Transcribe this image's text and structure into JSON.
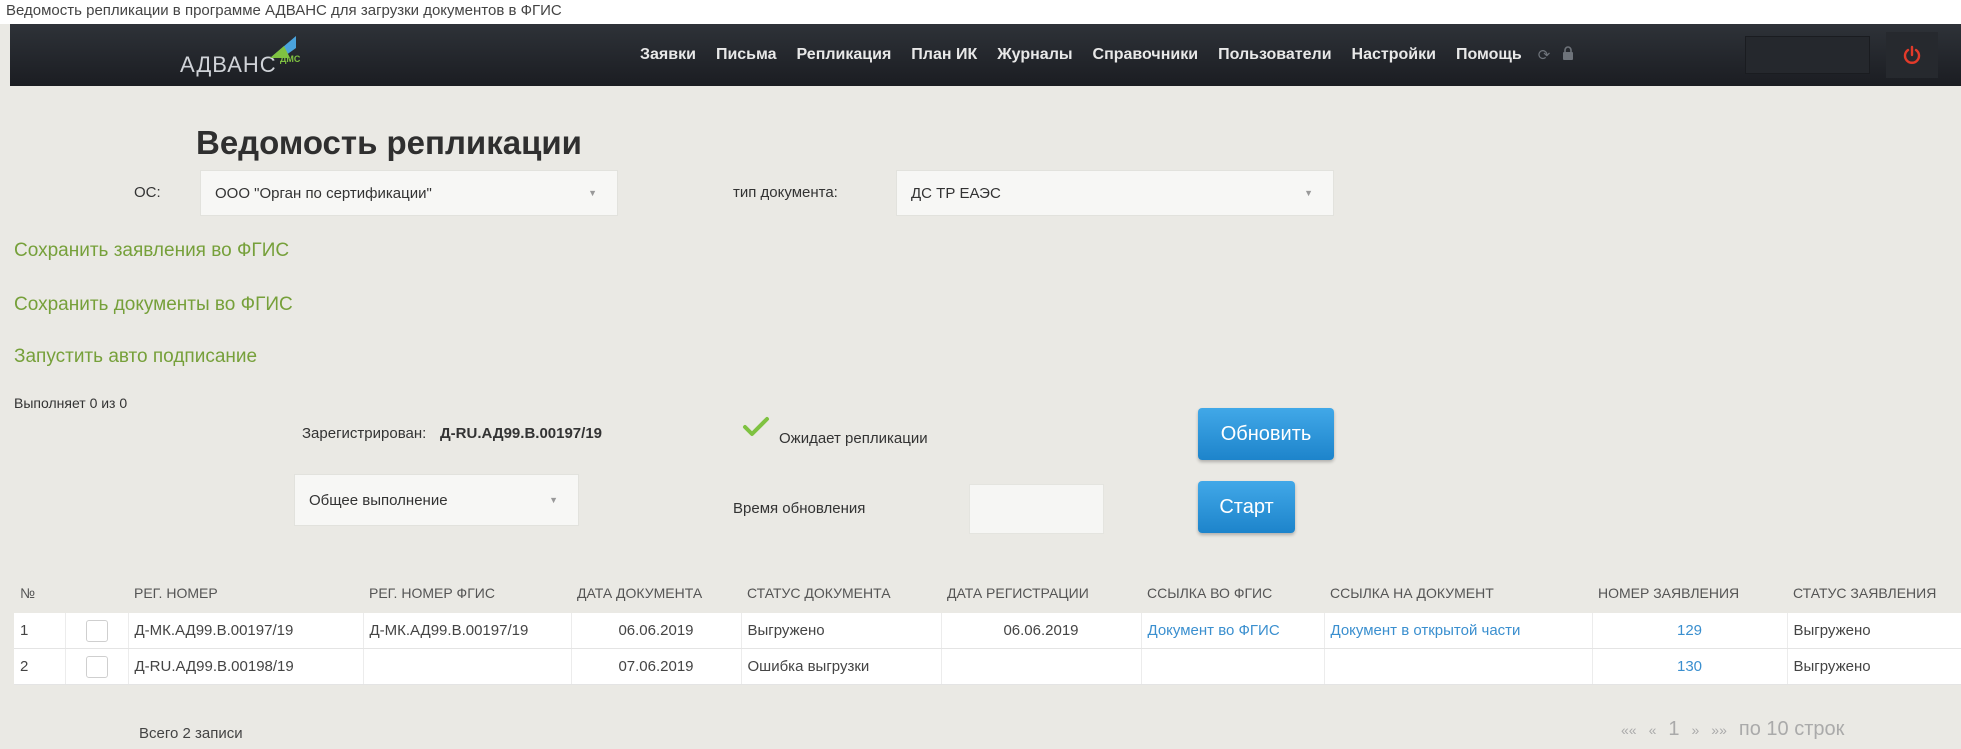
{
  "caption": "Ведомость репликации в программе АДВАНС для загрузки документов в ФГИС",
  "app": {
    "logo_text": "АДВАНС",
    "logo_sub": "ДМС",
    "accent": "#7fc241"
  },
  "nav": {
    "items": [
      "Заявки",
      "Письма",
      "Репликация",
      "План ИК",
      "Журналы",
      "Справочники",
      "Пользователи",
      "Настройки",
      "Помощь"
    ],
    "icons": [
      "refresh-icon",
      "lock-icon",
      "power-icon"
    ]
  },
  "page": {
    "title": "Ведомость репликации"
  },
  "filters": {
    "os_label": "ОС:",
    "os_value": "ООО \"Орган по сертификации\"",
    "doc_type_label": "тип документа:",
    "doc_type_value": "ДС ТР ЕАЭС"
  },
  "actions": {
    "save_applications": "Сохранить заявления во ФГИС",
    "save_documents": "Сохранить документы во ФГИС",
    "auto_sign": "Запустить авто подписание"
  },
  "progress_text": "Выполняет 0 из 0",
  "status": {
    "registered_label": "Зарегистрирован:",
    "registered_value": "Д-RU.АД99.В.00197/19",
    "awaiting_label": "Ожидает репликации",
    "awaiting_checked": true,
    "refresh_button": "Обновить",
    "mode_value": "Общее выполнение",
    "update_time_label": "Время обновления",
    "update_time_value": "",
    "start_button": "Старт"
  },
  "table": {
    "headers": [
      "№",
      "",
      "РЕГ. НОМЕР",
      "РЕГ. НОМЕР ФГИС",
      "ДАТА ДОКУМЕНТА",
      "СТАТУС ДОКУМЕНТА",
      "ДАТА РЕГИСТРАЦИИ",
      "ССЫЛКА ВО ФГИС",
      "ССЫЛКА НА ДОКУМЕНТ",
      "НОМЕР ЗАЯВЛЕНИЯ",
      "СТАТУС ЗАЯВЛЕНИЯ"
    ],
    "rows": [
      {
        "num": "1",
        "reg": "Д-МК.АД99.В.00197/19",
        "reg_fgis": "Д-МК.АД99.В.00197/19",
        "doc_date": "06.06.2019",
        "doc_status": "Выгружено",
        "reg_date": "06.06.2019",
        "link_fgis": "Документ во ФГИС",
        "link_doc": "Документ в открытой части",
        "app_num": "129",
        "app_status": "Выгружено"
      },
      {
        "num": "2",
        "reg": "Д-RU.АД99.В.00198/19",
        "reg_fgis": "",
        "doc_date": "07.06.2019",
        "doc_status": "Ошибка выгрузки",
        "reg_date": "",
        "link_fgis": "",
        "link_doc": "",
        "app_num": "130",
        "app_status": "Выгружено"
      }
    ]
  },
  "footer": {
    "total": "Всего 2 записи",
    "pager_first": "««",
    "pager_prev": "«",
    "page": "1",
    "pager_next": "»",
    "pager_last": "»»",
    "rows_per_page": "по 10 строк"
  }
}
